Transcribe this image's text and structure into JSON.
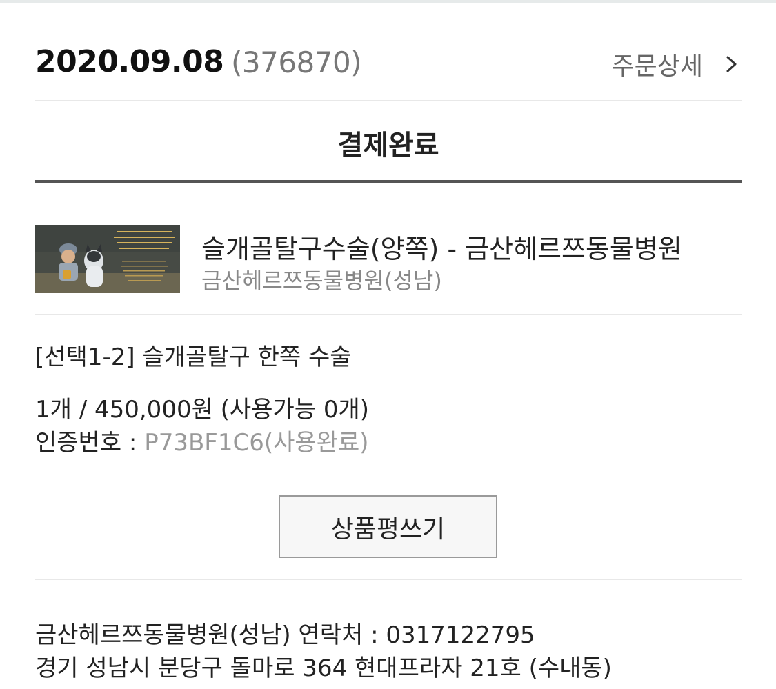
{
  "order": {
    "date": "2020.09.08",
    "number": "(376870)",
    "detail_label": "주문상세",
    "detail_icon": "chevron-right-icon"
  },
  "status": "결제완료",
  "product": {
    "image_icon": "product-thumbnail-image",
    "name": "슬개골탈구수술(양쪽) - 금산헤르쯔동물병원",
    "shop": "금산헤르쯔동물병원(성남)"
  },
  "option": {
    "title": "[선택1-2] 슬개골탈구 한쪽 수술",
    "quantity_price": "1개 / 450,000원 (사용가능 0개)",
    "auth_label": "인증번호 : ",
    "auth_code": "P73BF1C6(사용완료)"
  },
  "review_button": "상품평쓰기",
  "shop_info": {
    "contact": "금산헤르쯔동물병원(성남) 연락처 : 0317122795",
    "address": "경기 성남시 분당구 돌마로 364 현대프라자 21호 (수내동)"
  },
  "colors": {
    "thick_divider": "#555555",
    "thin_divider": "#e8e8e8",
    "muted_text": "#888888",
    "button_border": "#9a9a9a"
  }
}
